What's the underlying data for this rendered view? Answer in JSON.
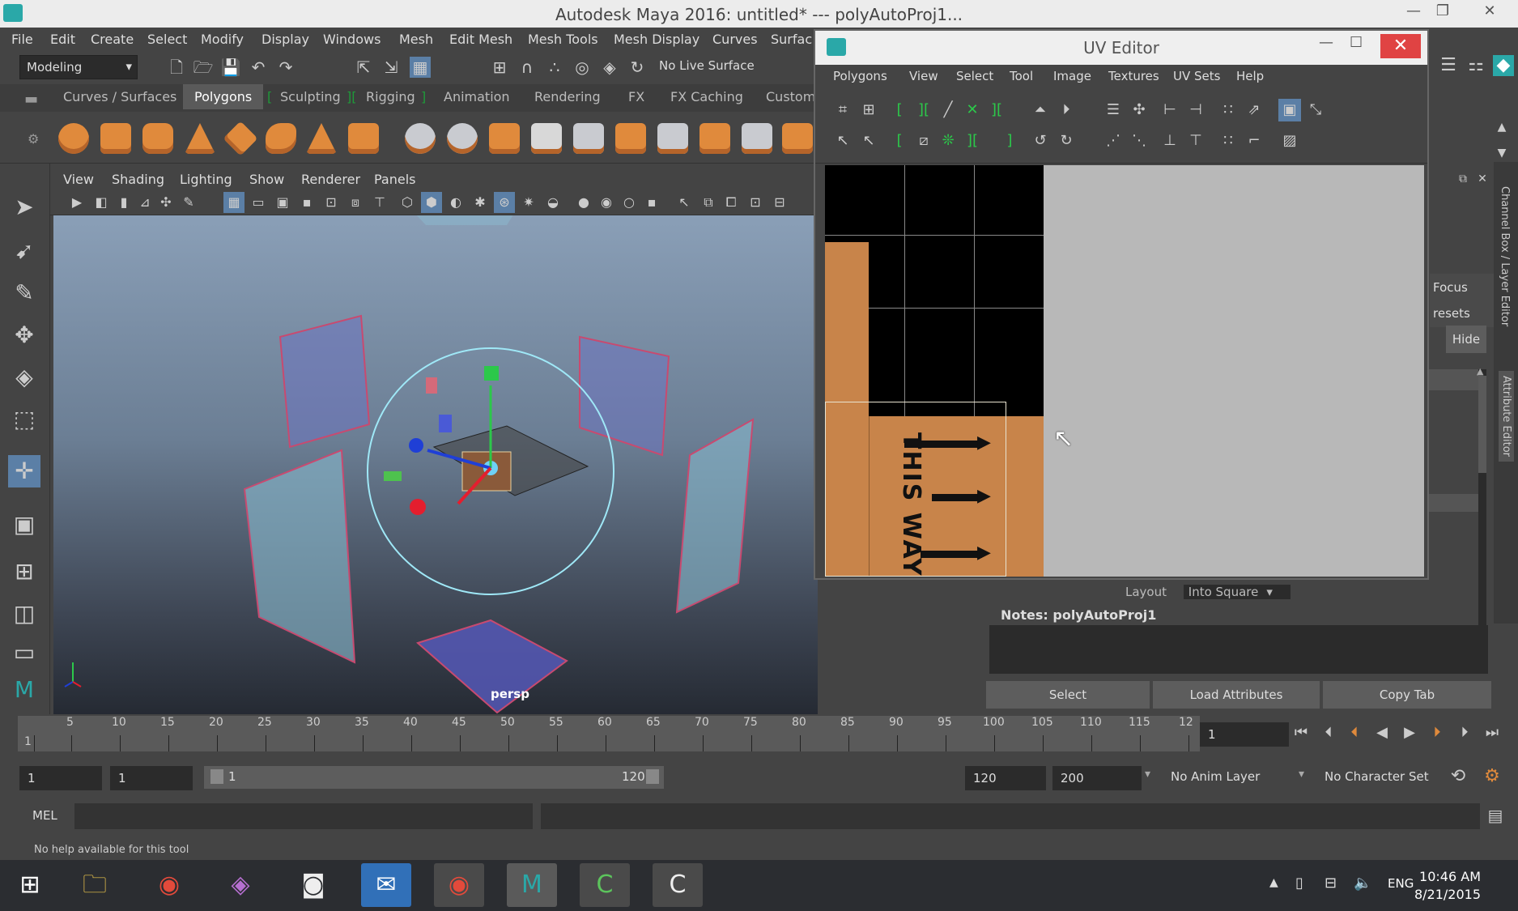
{
  "window": {
    "title": "Autodesk Maya 2016: untitled*   ---   polyAutoProj1...",
    "minimize": "—",
    "restore": "❐",
    "close": "✕"
  },
  "menu": [
    "File",
    "Edit",
    "Create",
    "Select",
    "Modify",
    "Display",
    "Windows",
    "Mesh",
    "Edit Mesh",
    "Mesh Tools",
    "Mesh Display",
    "Curves",
    "Surfac"
  ],
  "status": {
    "mode": "Modeling",
    "live_surface": "No Live Surface"
  },
  "shelf_tabs": [
    "Curves / Surfaces",
    "Polygons",
    "Sculpting",
    "Rigging",
    "Animation",
    "Rendering",
    "FX",
    "FX Caching",
    "Custom"
  ],
  "panel_menu": [
    "View",
    "Shading",
    "Lighting",
    "Show",
    "Renderer",
    "Panels"
  ],
  "viewport": {
    "camera": "persp"
  },
  "uv_editor": {
    "title": "UV Editor",
    "menu": [
      "Polygons",
      "View",
      "Select",
      "Tool",
      "Image",
      "Textures",
      "UV Sets",
      "Help"
    ],
    "texture_text": "THIS WAY UP"
  },
  "attr": {
    "focus": "Focus",
    "presets": "resets",
    "hide": "Hide",
    "layout_label": "Layout",
    "layout_value": "Into Square",
    "notes_label": "Notes:  polyAutoProj1",
    "select": "Select",
    "load_attributes": "Load Attributes",
    "copy_tab": "Copy Tab",
    "side_label_1": "Channel Box / Layer Editor",
    "side_label_2": "Attribute Editor"
  },
  "timeline": {
    "ticks": [
      "1",
      "5",
      "10",
      "15",
      "20",
      "25",
      "30",
      "35",
      "40",
      "45",
      "50",
      "55",
      "60",
      "65",
      "70",
      "75",
      "80",
      "85",
      "90",
      "95",
      "100",
      "105",
      "110",
      "115",
      "12"
    ],
    "current_frame": "1"
  },
  "range": {
    "start": "1",
    "playback_start": "1",
    "range_start_label": "1",
    "range_end_label": "120",
    "end": "120",
    "anim_end": "200",
    "anim_layer": "No Anim Layer",
    "character_set": "No Character Set"
  },
  "mel": {
    "label": "MEL"
  },
  "help": {
    "text": "No help available for this tool"
  },
  "taskbar": {
    "lang": "ENG",
    "time": "10:46 AM",
    "date": "8/21/2015"
  }
}
